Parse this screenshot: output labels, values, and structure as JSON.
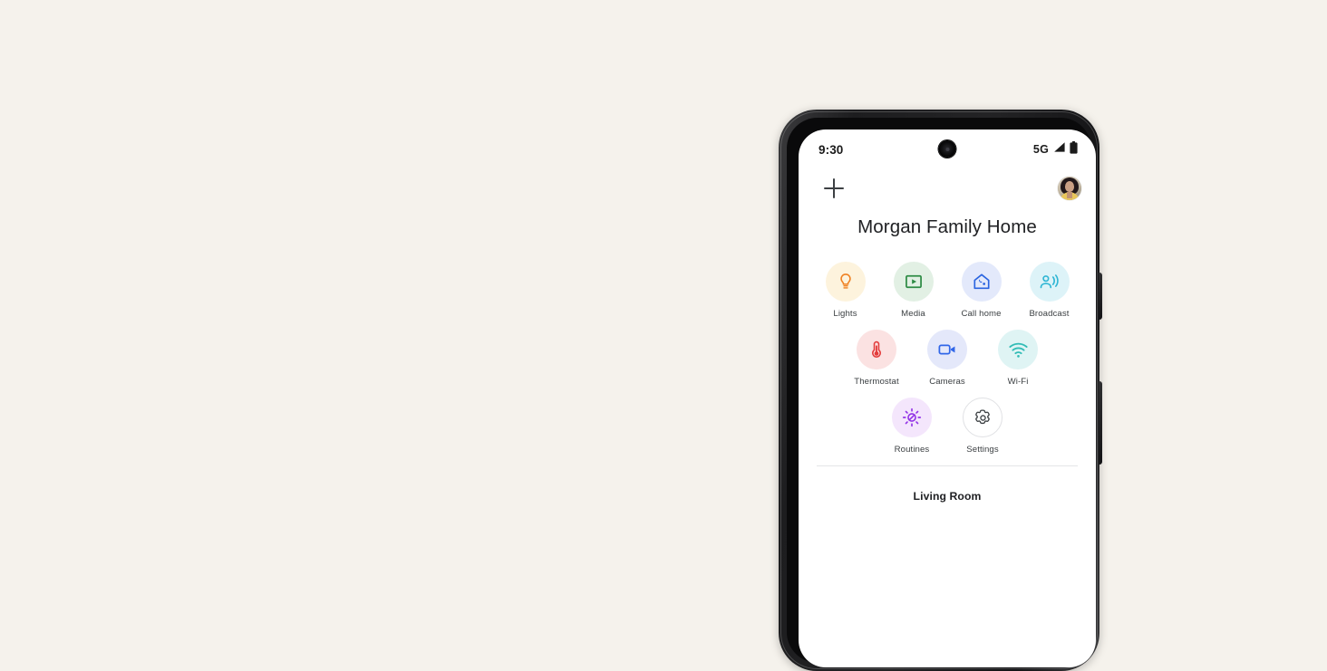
{
  "page": {
    "background_color": "#f5f2ec"
  },
  "device": {
    "frame_color": "#1d1d1f",
    "side_buttons": [
      {
        "name": "volume-rocker"
      },
      {
        "name": "power-button"
      }
    ]
  },
  "status_bar": {
    "time": "9:30",
    "network": "5G",
    "signal_icon": "signal-bars-icon",
    "battery_icon": "battery-full-icon",
    "camera_icon": "front-camera-punch-hole"
  },
  "app_bar": {
    "add_icon": "plus-icon",
    "add_label": "Add",
    "avatar_icon": "account-avatar"
  },
  "header": {
    "title": "Morgan Family Home"
  },
  "quick_actions": {
    "rows": [
      [
        {
          "label": "Lights",
          "icon": "lightbulb-icon",
          "bg": "#fdf3dd",
          "fg": "#ef8021"
        },
        {
          "label": "Media",
          "icon": "media-play-icon",
          "bg": "#e2f0e4",
          "fg": "#2e8b45"
        },
        {
          "label": "Call home",
          "icon": "call-home-icon",
          "bg": "#e3e9fb",
          "fg": "#2a64e0"
        },
        {
          "label": "Broadcast",
          "icon": "broadcast-icon",
          "bg": "#ddf3f8",
          "fg": "#2fb6d4"
        }
      ],
      [
        {
          "label": "Thermostat",
          "icon": "thermometer-icon",
          "bg": "#fbe2e2",
          "fg": "#e33b3b"
        },
        {
          "label": "Cameras",
          "icon": "video-camera-icon",
          "bg": "#e4e8fa",
          "fg": "#3066e8"
        },
        {
          "label": "Wi-Fi",
          "icon": "wifi-icon",
          "bg": "#dff4f4",
          "fg": "#31bcb6"
        }
      ],
      [
        {
          "label": "Routines",
          "icon": "routines-sun-icon",
          "bg": "#f4e6fc",
          "fg": "#9334e6"
        },
        {
          "label": "Settings",
          "icon": "gear-icon",
          "bg": "#ffffff",
          "fg": "#3c4043"
        }
      ]
    ]
  },
  "rooms": {
    "first_room_title": "Living Room"
  }
}
